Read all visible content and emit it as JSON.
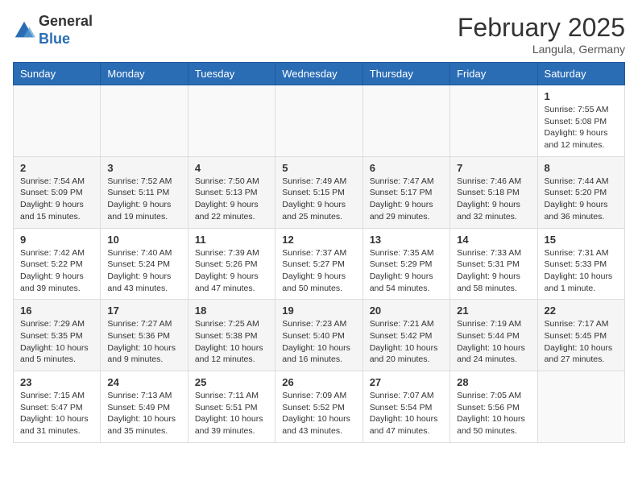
{
  "logo": {
    "general": "General",
    "blue": "Blue"
  },
  "title": "February 2025",
  "location": "Langula, Germany",
  "weekdays": [
    "Sunday",
    "Monday",
    "Tuesday",
    "Wednesday",
    "Thursday",
    "Friday",
    "Saturday"
  ],
  "weeks": [
    [
      {
        "day": "",
        "info": ""
      },
      {
        "day": "",
        "info": ""
      },
      {
        "day": "",
        "info": ""
      },
      {
        "day": "",
        "info": ""
      },
      {
        "day": "",
        "info": ""
      },
      {
        "day": "",
        "info": ""
      },
      {
        "day": "1",
        "info": "Sunrise: 7:55 AM\nSunset: 5:08 PM\nDaylight: 9 hours and 12 minutes."
      }
    ],
    [
      {
        "day": "2",
        "info": "Sunrise: 7:54 AM\nSunset: 5:09 PM\nDaylight: 9 hours and 15 minutes."
      },
      {
        "day": "3",
        "info": "Sunrise: 7:52 AM\nSunset: 5:11 PM\nDaylight: 9 hours and 19 minutes."
      },
      {
        "day": "4",
        "info": "Sunrise: 7:50 AM\nSunset: 5:13 PM\nDaylight: 9 hours and 22 minutes."
      },
      {
        "day": "5",
        "info": "Sunrise: 7:49 AM\nSunset: 5:15 PM\nDaylight: 9 hours and 25 minutes."
      },
      {
        "day": "6",
        "info": "Sunrise: 7:47 AM\nSunset: 5:17 PM\nDaylight: 9 hours and 29 minutes."
      },
      {
        "day": "7",
        "info": "Sunrise: 7:46 AM\nSunset: 5:18 PM\nDaylight: 9 hours and 32 minutes."
      },
      {
        "day": "8",
        "info": "Sunrise: 7:44 AM\nSunset: 5:20 PM\nDaylight: 9 hours and 36 minutes."
      }
    ],
    [
      {
        "day": "9",
        "info": "Sunrise: 7:42 AM\nSunset: 5:22 PM\nDaylight: 9 hours and 39 minutes."
      },
      {
        "day": "10",
        "info": "Sunrise: 7:40 AM\nSunset: 5:24 PM\nDaylight: 9 hours and 43 minutes."
      },
      {
        "day": "11",
        "info": "Sunrise: 7:39 AM\nSunset: 5:26 PM\nDaylight: 9 hours and 47 minutes."
      },
      {
        "day": "12",
        "info": "Sunrise: 7:37 AM\nSunset: 5:27 PM\nDaylight: 9 hours and 50 minutes."
      },
      {
        "day": "13",
        "info": "Sunrise: 7:35 AM\nSunset: 5:29 PM\nDaylight: 9 hours and 54 minutes."
      },
      {
        "day": "14",
        "info": "Sunrise: 7:33 AM\nSunset: 5:31 PM\nDaylight: 9 hours and 58 minutes."
      },
      {
        "day": "15",
        "info": "Sunrise: 7:31 AM\nSunset: 5:33 PM\nDaylight: 10 hours and 1 minute."
      }
    ],
    [
      {
        "day": "16",
        "info": "Sunrise: 7:29 AM\nSunset: 5:35 PM\nDaylight: 10 hours and 5 minutes."
      },
      {
        "day": "17",
        "info": "Sunrise: 7:27 AM\nSunset: 5:36 PM\nDaylight: 10 hours and 9 minutes."
      },
      {
        "day": "18",
        "info": "Sunrise: 7:25 AM\nSunset: 5:38 PM\nDaylight: 10 hours and 12 minutes."
      },
      {
        "day": "19",
        "info": "Sunrise: 7:23 AM\nSunset: 5:40 PM\nDaylight: 10 hours and 16 minutes."
      },
      {
        "day": "20",
        "info": "Sunrise: 7:21 AM\nSunset: 5:42 PM\nDaylight: 10 hours and 20 minutes."
      },
      {
        "day": "21",
        "info": "Sunrise: 7:19 AM\nSunset: 5:44 PM\nDaylight: 10 hours and 24 minutes."
      },
      {
        "day": "22",
        "info": "Sunrise: 7:17 AM\nSunset: 5:45 PM\nDaylight: 10 hours and 27 minutes."
      }
    ],
    [
      {
        "day": "23",
        "info": "Sunrise: 7:15 AM\nSunset: 5:47 PM\nDaylight: 10 hours and 31 minutes."
      },
      {
        "day": "24",
        "info": "Sunrise: 7:13 AM\nSunset: 5:49 PM\nDaylight: 10 hours and 35 minutes."
      },
      {
        "day": "25",
        "info": "Sunrise: 7:11 AM\nSunset: 5:51 PM\nDaylight: 10 hours and 39 minutes."
      },
      {
        "day": "26",
        "info": "Sunrise: 7:09 AM\nSunset: 5:52 PM\nDaylight: 10 hours and 43 minutes."
      },
      {
        "day": "27",
        "info": "Sunrise: 7:07 AM\nSunset: 5:54 PM\nDaylight: 10 hours and 47 minutes."
      },
      {
        "day": "28",
        "info": "Sunrise: 7:05 AM\nSunset: 5:56 PM\nDaylight: 10 hours and 50 minutes."
      },
      {
        "day": "",
        "info": ""
      }
    ]
  ]
}
